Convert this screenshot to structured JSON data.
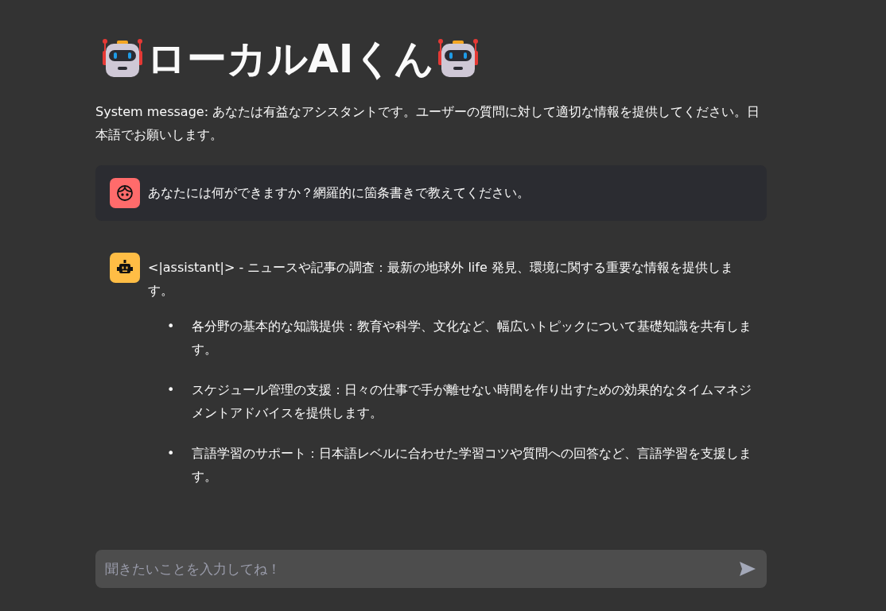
{
  "title": "ローカルAIくん",
  "system_message": "System message: あなたは有益なアシスタントです。ユーザーの質問に対して適切な情報を提供してください。日本語でお願いします。",
  "messages": [
    {
      "kind": "user",
      "text": "あなたには何ができますか？網羅的に箇条書きで教えてください。"
    },
    {
      "kind": "assistant",
      "text": "<|assistant|> - ニュースや記事の調査：最新の地球外 life 発見、環境に関する重要な情報を提供します。",
      "bullets": [
        {
          "marker": "•",
          "text": "各分野の基本的な知識提供：教育や科学、文化など、幅広いトピックについて基礎知識を共有します。"
        },
        {
          "marker": "•",
          "text": "スケジュール管理の支援：日々の仕事で手が離せない時間を作り出すための効果的なタイムマネジメントアドバイスを提供します。"
        },
        {
          "marker": "•",
          "text": "言語学習のサポート：日本語レベルに合わせた学習コツや質問への回答など、言語学習を支援します。"
        }
      ]
    }
  ],
  "chat_input": {
    "placeholder": "聞きたいことを入力してね！"
  }
}
